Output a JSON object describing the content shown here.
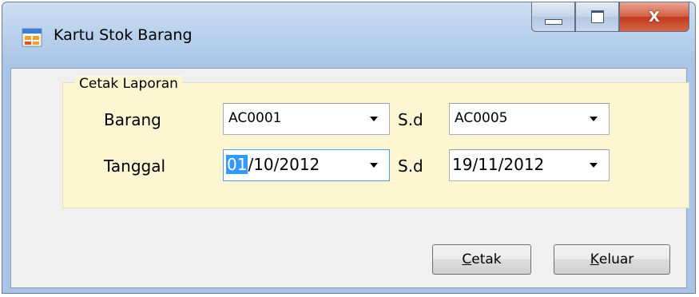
{
  "window": {
    "title": "Kartu Stok Barang",
    "close_glyph": "X"
  },
  "group": {
    "title": "Cetak Laporan"
  },
  "barang": {
    "label": "Barang",
    "from_value": "AC0001",
    "to_label": "S.d",
    "to_value": "AC0005"
  },
  "tanggal": {
    "label": "Tanggal",
    "from_day_selected": "01",
    "from_rest": "/10/2012",
    "to_label": "S.d",
    "to_value": "19/11/2012"
  },
  "buttons": {
    "cetak_mnemonic": "C",
    "cetak_rest": "etak",
    "keluar_mnemonic": "K",
    "keluar_rest": "eluar"
  },
  "colors": {
    "group_background": "#fdf6d3",
    "selection": "#3399ff",
    "close_button": "#c3381b"
  },
  "icons": {
    "app": "form-window-icon",
    "minimize": "minimize-icon",
    "maximize": "maximize-icon",
    "close": "close-icon",
    "dropdown": "chevron-down-icon"
  }
}
